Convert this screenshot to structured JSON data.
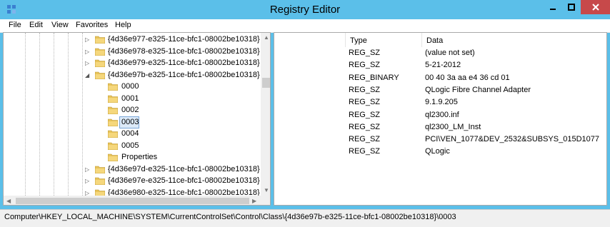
{
  "window": {
    "title": "Registry Editor"
  },
  "menu": [
    "File",
    "Edit",
    "View",
    "Favorites",
    "Help"
  ],
  "tree": {
    "nodes": [
      {
        "label": "{4d36e977-e325-11ce-bfc1-08002be10318}",
        "level": 0,
        "expander": "collapsed"
      },
      {
        "label": "{4d36e978-e325-11ce-bfc1-08002be10318}",
        "level": 0,
        "expander": "collapsed"
      },
      {
        "label": "{4d36e979-e325-11ce-bfc1-08002be10318}",
        "level": 0,
        "expander": "collapsed"
      },
      {
        "label": "{4d36e97b-e325-11ce-bfc1-08002be10318}",
        "level": 0,
        "expander": "expanded"
      },
      {
        "label": "0000",
        "level": 1,
        "expander": "none"
      },
      {
        "label": "0001",
        "level": 1,
        "expander": "none"
      },
      {
        "label": "0002",
        "level": 1,
        "expander": "none"
      },
      {
        "label": "0003",
        "level": 1,
        "expander": "none",
        "selected": true
      },
      {
        "label": "0004",
        "level": 1,
        "expander": "none"
      },
      {
        "label": "0005",
        "level": 1,
        "expander": "none"
      },
      {
        "label": "Properties",
        "level": 1,
        "expander": "none"
      },
      {
        "label": "{4d36e97d-e325-11ce-bfc1-08002be10318}",
        "level": 0,
        "expander": "collapsed"
      },
      {
        "label": "{4d36e97e-e325-11ce-bfc1-08002be10318}",
        "level": 0,
        "expander": "collapsed"
      },
      {
        "label": "{4d36e980-e325-11ce-bfc1-08002be10318}",
        "level": 0,
        "expander": "collapsed"
      }
    ]
  },
  "list": {
    "columns": [
      "Type",
      "Data"
    ],
    "rows": [
      {
        "type": "REG_SZ",
        "data": "(value not set)"
      },
      {
        "type": "REG_SZ",
        "data": "5-21-2012"
      },
      {
        "type": "REG_BINARY",
        "data": "00 40 3a aa e4 36 cd 01"
      },
      {
        "type": "REG_SZ",
        "data": "QLogic Fibre Channel Adapter"
      },
      {
        "type": "REG_SZ",
        "data": "9.1.9.205"
      },
      {
        "type": "REG_SZ",
        "data": "ql2300.inf"
      },
      {
        "type": "REG_SZ",
        "data": "ql2300_LM_Inst"
      },
      {
        "type": "REG_SZ",
        "data": "PCI\\VEN_1077&DEV_2532&SUBSYS_015D1077"
      },
      {
        "type": "REG_SZ",
        "data": "QLogic"
      }
    ]
  },
  "status": {
    "path": "Computer\\HKEY_LOCAL_MACHINE\\SYSTEM\\CurrentControlSet\\Control\\Class\\{4d36e97b-e325-11ce-bfc1-08002be10318}\\0003"
  },
  "colors": {
    "chrome": "#5bbfe9",
    "close": "#c7494a",
    "folder": "#e8c45a",
    "selection": "#dceaf8"
  },
  "icons": {
    "app": "registry-icon",
    "folder": "folder-icon",
    "minimize": "minimize-icon",
    "maximize": "maximize-icon",
    "close": "close-icon"
  }
}
